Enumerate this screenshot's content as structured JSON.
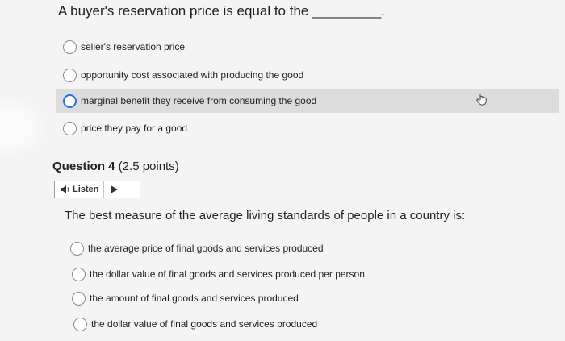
{
  "question3": {
    "prompt": "A buyer's reservation price is equal to the _________.",
    "options": [
      {
        "label": "seller's reservation price"
      },
      {
        "label": "opportunity cost associated with producing the good"
      },
      {
        "label": "marginal benefit they receive from consuming the good"
      },
      {
        "label": "price they pay for a good"
      }
    ]
  },
  "question4": {
    "heading_bold": "Question 4",
    "heading_points": " (2.5 points)",
    "listen_label": "Listen",
    "prompt": "The best measure of the average living standards of people in a country is:",
    "options": [
      {
        "label": "the average price of final goods and services produced"
      },
      {
        "label": "the dollar value of final goods and services produced per person"
      },
      {
        "label": "the amount of final goods and services produced"
      },
      {
        "label": "the dollar value of final goods and services produced"
      }
    ]
  },
  "colors": {
    "highlight": "#dcdcdc",
    "focus_ring": "#2a6fdb",
    "page_bg": "#f4f4f4"
  },
  "icons": [
    "speaker-icon",
    "play-icon",
    "hand-pointer-icon"
  ]
}
